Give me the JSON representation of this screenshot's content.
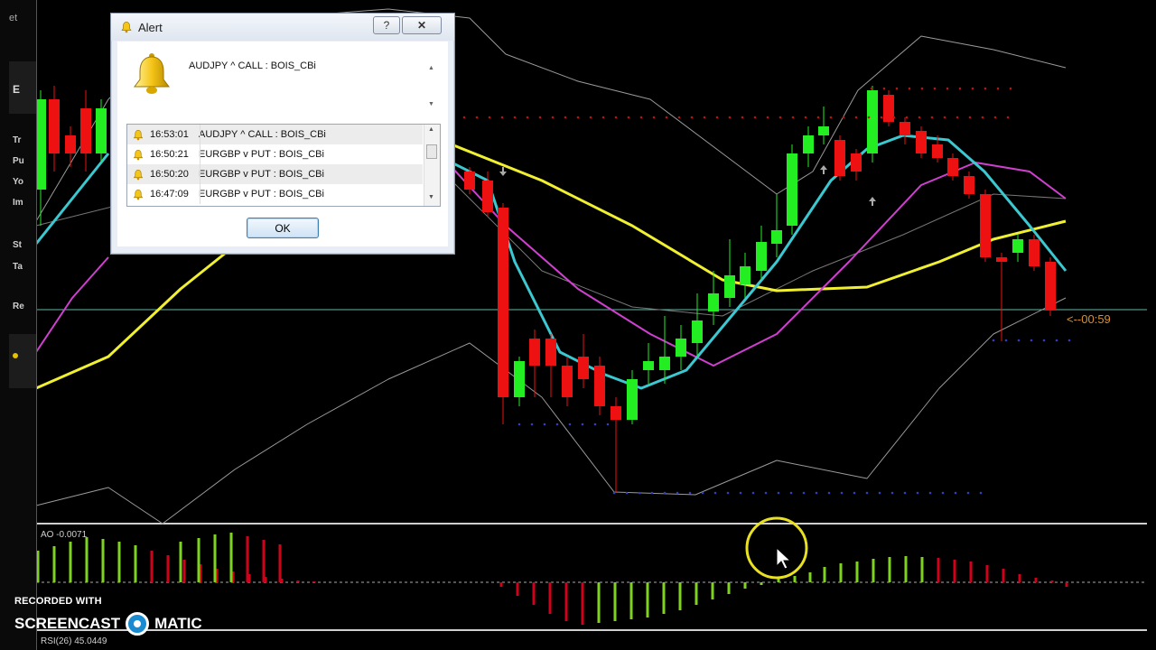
{
  "app": {
    "left_panel_top_text": "et",
    "left_panel_labels": [
      "E",
      "Tr",
      "Pu",
      "Yo",
      "Im",
      "St",
      "Ta",
      "Re"
    ]
  },
  "dialog": {
    "title": "Alert",
    "help_label": "?",
    "close_label": "✕",
    "message": "AUDJPY ^ CALL : BOIS_CBi",
    "alerts": [
      {
        "time": "16:53:01",
        "text": "AUDJPY ^ CALL : BOIS_CBi"
      },
      {
        "time": "16:50:21",
        "text": "EURGBP v PUT : BOIS_CBi"
      },
      {
        "time": "16:50:20",
        "text": "EURGBP v PUT : BOIS_CBi"
      },
      {
        "time": "16:47:09",
        "text": "EURGBP v PUT : BOIS_CBi"
      }
    ],
    "selected_index": 0,
    "ok_label": "OK"
  },
  "chart": {
    "timer_text": "<--00:59",
    "ao_label": "AO -0.0071",
    "rsi_label": "RSI(26) 45.0449",
    "colors": {
      "background": "#000000",
      "bull": "#22ee22",
      "bear": "#ee1111",
      "fast_ma": "#3cc8d0",
      "mid_ma": "#d040d0",
      "slow_ma": "#f0f030",
      "bands": "#9a9a9a",
      "ao_up": "#7ed321",
      "ao_down": "#d0021b",
      "price_line": "#5fb8a8"
    }
  },
  "watermark": {
    "line1": "RECORDED WITH",
    "brand_left": "SCREENCAST",
    "brand_right": "MATIC"
  }
}
